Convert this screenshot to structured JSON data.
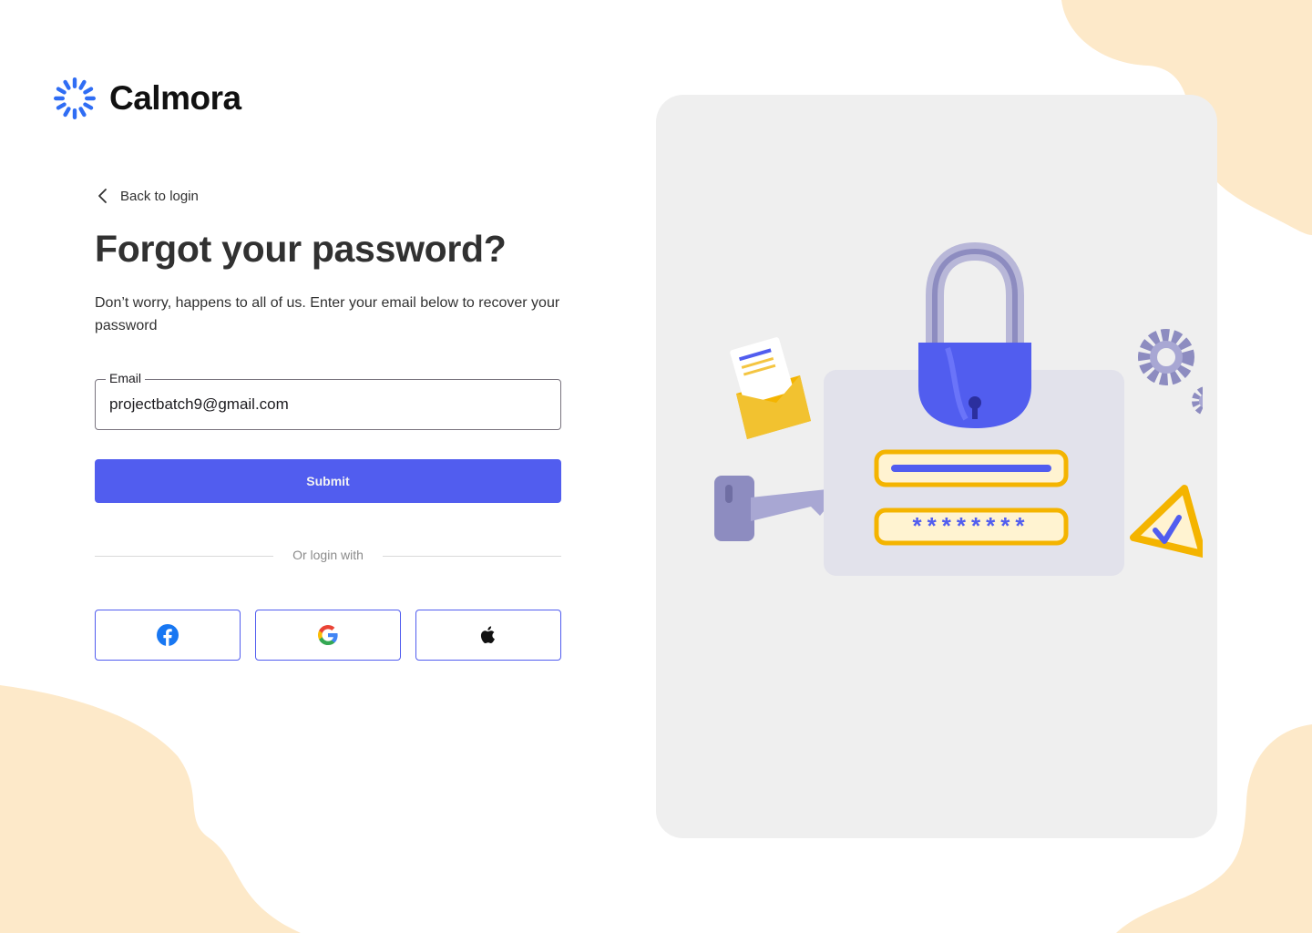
{
  "brand": {
    "name": "Calmora",
    "logo_icon": "sunburst-logo-icon",
    "color": "#2f6df4"
  },
  "back_link": {
    "label": "Back to login",
    "icon": "chevron-left-icon"
  },
  "heading": "Forgot your password?",
  "subtitle": "Don’t worry, happens to all of us. Enter your email below to recover your password",
  "email_field": {
    "label": "Email",
    "value": "projectbatch9@gmail.com"
  },
  "submit_button": {
    "label": "Submit",
    "color": "#515def"
  },
  "divider_text": "Or login with",
  "social_buttons": [
    {
      "icon": "facebook-icon"
    },
    {
      "icon": "google-icon"
    },
    {
      "icon": "apple-icon"
    }
  ],
  "illustration": {
    "icon": "password-security-illustration",
    "masked_password": "********"
  },
  "colors": {
    "background": "#ffffff",
    "blob": "#fde9c9",
    "card": "#efefef",
    "text": "#313131"
  }
}
